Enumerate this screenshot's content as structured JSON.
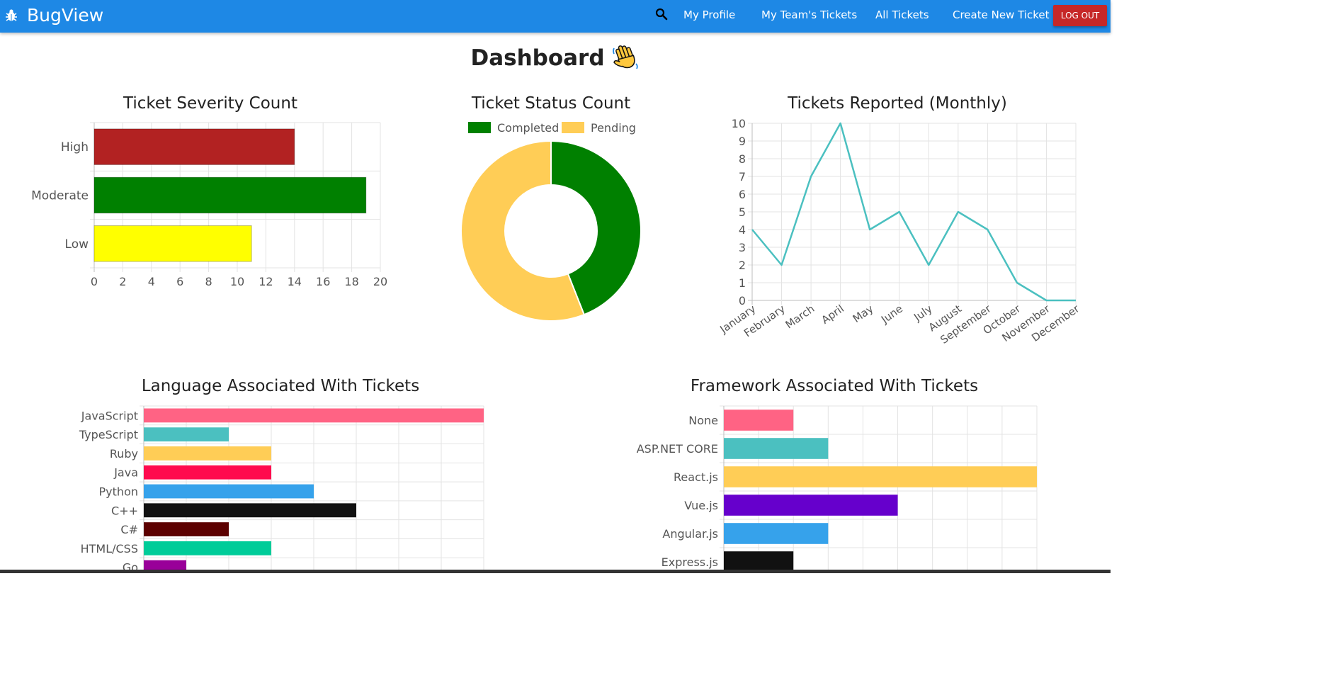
{
  "app": {
    "brand": "BugView",
    "nav": [
      "My Profile",
      "My Team's Tickets",
      "All Tickets",
      "Create New Ticket"
    ],
    "logout_label": "LOG OUT"
  },
  "page": {
    "title": "Dashboard"
  },
  "colors": {
    "navbar": "#1e88e5",
    "logout": "#c62828",
    "teal": "#4bc0c0"
  },
  "chart_data": [
    {
      "type": "bar",
      "orientation": "horizontal",
      "title": "Ticket Severity Count",
      "categories": [
        "High",
        "Moderate",
        "Low"
      ],
      "values": [
        14,
        19,
        11
      ],
      "colors": [
        "#b22222",
        "#008000",
        "#ffff00"
      ],
      "xlim": [
        0,
        20
      ],
      "xticks": [
        0,
        2,
        4,
        6,
        8,
        10,
        12,
        14,
        16,
        18,
        20
      ],
      "grid": true
    },
    {
      "type": "pie",
      "variant": "doughnut",
      "title": "Ticket Status Count",
      "labels": [
        "Completed",
        "Pending"
      ],
      "values": [
        44,
        56
      ],
      "colors": [
        "#008000",
        "#ffcd56"
      ],
      "legend": "top"
    },
    {
      "type": "line",
      "title": "Tickets Reported (Monthly)",
      "categories": [
        "January",
        "February",
        "March",
        "April",
        "May",
        "June",
        "July",
        "August",
        "September",
        "October",
        "November",
        "December"
      ],
      "values": [
        4,
        2,
        7,
        10,
        4,
        5,
        2,
        5,
        4,
        1,
        0,
        0
      ],
      "color": "#4bc0c0",
      "ylim": [
        0,
        10
      ],
      "yticks": [
        0,
        1,
        2,
        3,
        4,
        5,
        6,
        7,
        8,
        9,
        10
      ],
      "grid": true
    },
    {
      "type": "bar",
      "orientation": "horizontal",
      "title": "Language Associated With Tickets",
      "categories": [
        "JavaScript",
        "TypeScript",
        "Ruby",
        "Java",
        "Python",
        "C++",
        "C#",
        "HTML/CSS",
        "Go"
      ],
      "values": [
        8,
        2,
        3,
        3,
        4,
        5,
        2,
        3,
        1
      ],
      "colors": [
        "#ff6384",
        "#4bc0c0",
        "#ffcd56",
        "#ff0a4e",
        "#36a2eb",
        "#111111",
        "#5c0000",
        "#00cc99",
        "#990099"
      ],
      "xlim": [
        0,
        8
      ],
      "grid": true
    },
    {
      "type": "bar",
      "orientation": "horizontal",
      "title": "Framework Associated With Tickets",
      "categories": [
        "None",
        "ASP.NET CORE",
        "React.js",
        "Vue.js",
        "Angular.js",
        "Express.js"
      ],
      "values": [
        2,
        3,
        9,
        5,
        3,
        2
      ],
      "colors": [
        "#ff6384",
        "#4bc0c0",
        "#ffcd56",
        "#6600cc",
        "#36a2eb",
        "#111111"
      ],
      "xlim": [
        0,
        9
      ],
      "grid": true
    }
  ]
}
